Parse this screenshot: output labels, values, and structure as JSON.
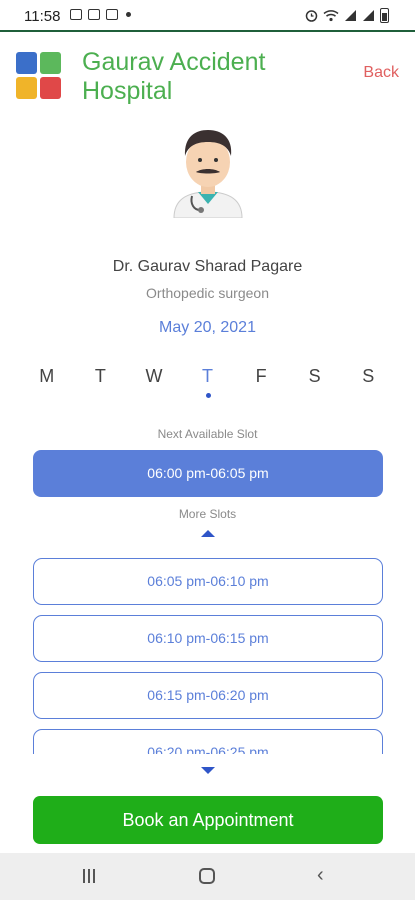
{
  "status_bar": {
    "time": "11:58",
    "left_icons": [
      "image-icon",
      "notification-icon",
      "app-icon",
      "dot-icon"
    ],
    "right_icons": [
      "alarm-icon",
      "wifi-icon",
      "signal-icon",
      "signal-icon",
      "battery-icon"
    ]
  },
  "header": {
    "hospital_name": "Gaurav Accident Hospital",
    "back_label": "Back",
    "logo": "hospital-logo-icon"
  },
  "doctor": {
    "avatar": "doctor-avatar-icon",
    "name": "Dr. Gaurav Sharad Pagare",
    "specialty": "Orthopedic surgeon"
  },
  "date": "May 20, 2021",
  "weekdays": [
    {
      "label": "M",
      "active": false
    },
    {
      "label": "T",
      "active": false
    },
    {
      "label": "W",
      "active": false
    },
    {
      "label": "T",
      "active": true
    },
    {
      "label": "F",
      "active": false
    },
    {
      "label": "S",
      "active": false
    },
    {
      "label": "S",
      "active": false
    }
  ],
  "next_slot": {
    "label": "Next Available Slot",
    "value": "06:00 pm-06:05 pm"
  },
  "more_slots": {
    "label": "More Slots",
    "slots": [
      "06:05 pm-06:10 pm",
      "06:10 pm-06:15 pm",
      "06:15 pm-06:20 pm",
      "06:20 pm-06:25 pm"
    ]
  },
  "book_button": "Book an Appointment",
  "colors": {
    "brand_green": "#4caf50",
    "accent_blue": "#5b7fd9",
    "button_green": "#1fae19",
    "back_red": "#e06060"
  },
  "nav": [
    "recents-icon",
    "home-icon",
    "back-icon"
  ]
}
